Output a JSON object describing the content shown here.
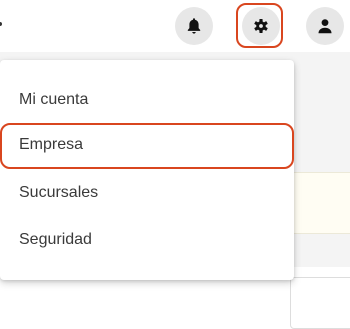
{
  "header": {
    "notifications_icon": "bell-icon",
    "settings_icon": "gear-icon",
    "profile_icon": "user-icon"
  },
  "settings_menu": {
    "items": [
      {
        "label": "Mi cuenta"
      },
      {
        "label": "Empresa",
        "highlighted": true
      },
      {
        "label": "Sucursales"
      },
      {
        "label": "Seguridad"
      }
    ]
  },
  "colors": {
    "highlight": "#d9461f",
    "icon": "#111111",
    "icon_button_bg": "#e7e7e7",
    "menu_text": "#3a3a3a"
  }
}
